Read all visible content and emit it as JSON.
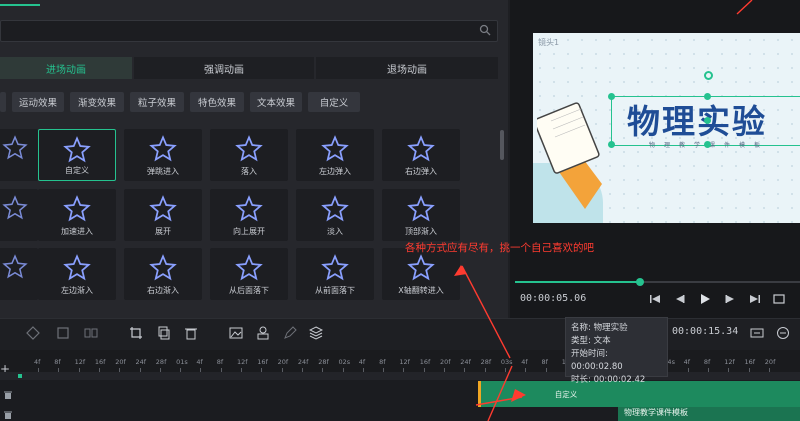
{
  "search": {
    "placeholder": ""
  },
  "tabs": [
    {
      "label": "进场动画"
    },
    {
      "label": "强调动画"
    },
    {
      "label": "退场动画"
    }
  ],
  "chips": [
    {
      "label": "运动效果"
    },
    {
      "label": "渐变效果"
    },
    {
      "label": "粒子效果"
    },
    {
      "label": "特色效果"
    },
    {
      "label": "文本效果"
    },
    {
      "label": "自定义"
    }
  ],
  "effects": [
    {
      "label": "自定义"
    },
    {
      "label": "弹跳进入"
    },
    {
      "label": "落入"
    },
    {
      "label": "左边弹入"
    },
    {
      "label": "右边弹入"
    },
    {
      "label": "加速进入"
    },
    {
      "label": "展开"
    },
    {
      "label": "向上展开"
    },
    {
      "label": "淡入"
    },
    {
      "label": "顶部渐入"
    },
    {
      "label": "左边渐入"
    },
    {
      "label": "右边渐入"
    },
    {
      "label": "从后面落下"
    },
    {
      "label": "从前面落下"
    },
    {
      "label": "X轴翻转进入"
    }
  ],
  "preview": {
    "mirror_label": "镜头1",
    "title": "物理实验",
    "subtitle": "物理教学课件模板"
  },
  "playback": {
    "current_time": "00:00:05.06",
    "total_time": "00:00:15.34",
    "progress_fraction": 0.43
  },
  "tooltip": {
    "name": "名称: 物理实验",
    "type": "类型: 文本",
    "start": "开始时间: 00:00:02.80",
    "duration": "时长: 00:00:02.42"
  },
  "ruler": {
    "labels": [
      "4f",
      "8f",
      "12f",
      "16f",
      "20f",
      "24f",
      "28f",
      "01s",
      "4f",
      "8f",
      "12f",
      "16f",
      "20f",
      "24f",
      "28f",
      "02s",
      "4f",
      "8f",
      "12f",
      "16f",
      "20f",
      "24f",
      "28f",
      "03s",
      "4f",
      "8f",
      "12f",
      "16f",
      "20f",
      "24f",
      "28f",
      "04s",
      "4f",
      "8f",
      "12f",
      "16f",
      "20f"
    ]
  },
  "timeline": {
    "clip_label": "自定义",
    "clip2_label": "物理教学课件模板"
  },
  "annotation": {
    "text": "各种方式应有尽有，挑一个自己喜欢的吧"
  },
  "colors": {
    "accent": "#25c28f",
    "annotation": "#ff3b30",
    "clip": "#1d8a5e"
  }
}
